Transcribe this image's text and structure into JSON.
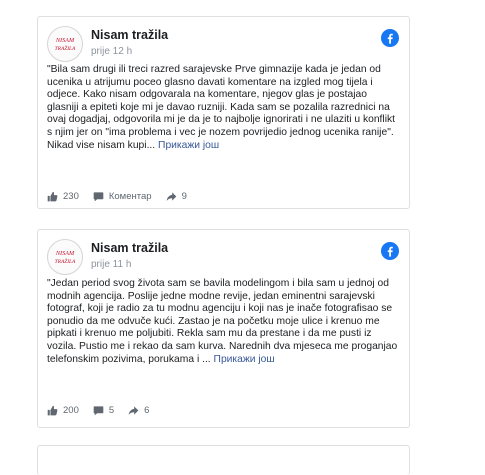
{
  "posts": [
    {
      "page_name": "Nisam tražila",
      "avatar_text": [
        "NISAM",
        "TRAŽILA"
      ],
      "time": "prije 12 h",
      "text": "\"Bila sam drugi ili treci razred sarajevske Prve gimnazije kada je jedan od ucenika u atrijumu poceo glasno davati komentare na izgled mog tijela i odjece. Kako nisam odgovarala na komentare, njegov glas je postajao glasniji a epiteti koje mi je davao ruzniji. Kada sam se pozalila razrednici na ovaj dogadjaj, odgovorila mi je da je to najbolje ignorirati i ne ulaziti u konflikt s njim jer on \"ima problema i vec je nozem povrijedio jednog ucenika ranije\". Nikad vise nisam kupi...",
      "see_more": "Прикажи још",
      "likes": "230",
      "comments": "Коментар",
      "shares": "9"
    },
    {
      "page_name": "Nisam tražila",
      "avatar_text": [
        "NISAM",
        "TRAŽILA"
      ],
      "time": "prije 11 h",
      "text": "\"Jedan period svog života sam se bavila modelingom i bila sam u jednoj od modnih agencija. Poslije jedne modne revije, jedan eminentni sarajevski fotograf, koji je radio za tu modnu agenciju i koji nas je inače fotografisao se ponudio da me odvuče kući. Zastao je na početku moje ulice i krenuo me pipkati i krenuo me poljubiti. Rekla sam mu da prestane i da me pusti iz vozila. Pustio me i rekao da sam kurva. Narednih dva mjeseca me proganjao telefonskim pozivima, porukama i ...",
      "see_more": "Прикажи још",
      "likes": "200",
      "comments": "5",
      "shares": "6"
    }
  ],
  "colors": {
    "facebook_blue": "#1877f2",
    "link": "#385898",
    "muted": "#606770",
    "avatar_red": "#c8102e"
  }
}
